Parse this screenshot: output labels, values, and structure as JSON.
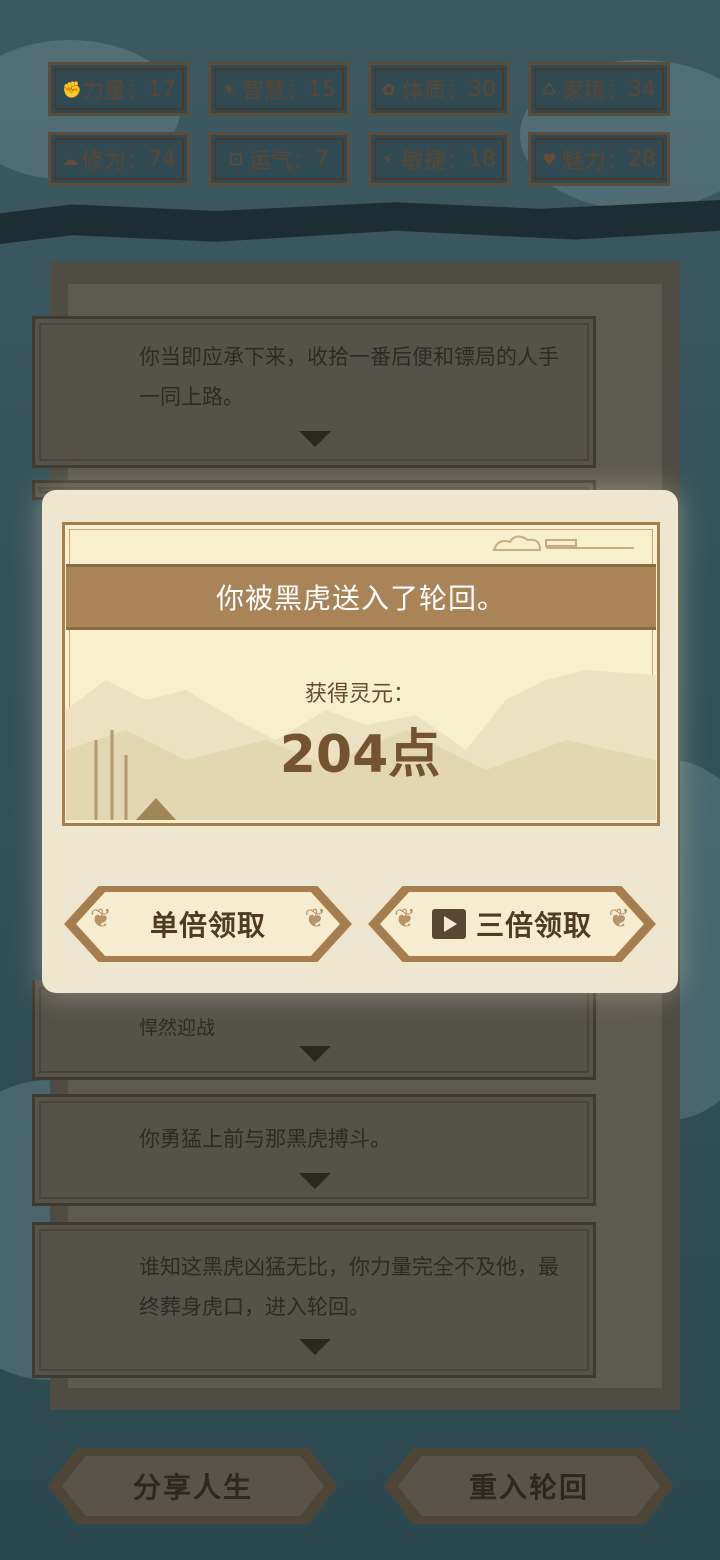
{
  "stats": [
    {
      "icon": "fist-icon",
      "glyph": "✊",
      "label": "力量",
      "value": "17"
    },
    {
      "icon": "bulb-icon",
      "glyph": "☀",
      "label": "智慧",
      "value": "15"
    },
    {
      "icon": "flower-icon",
      "glyph": "✿",
      "label": "体质",
      "value": "30"
    },
    {
      "icon": "hands-icon",
      "glyph": "♺",
      "label": "家境",
      "value": "34"
    },
    {
      "icon": "cloud-icon",
      "glyph": "☁",
      "label": "修为",
      "value": "74"
    },
    {
      "icon": "dice-icon",
      "glyph": "⚀",
      "label": "运气",
      "value": " 7"
    },
    {
      "icon": "lightning-icon",
      "glyph": "⚡",
      "label": "敏捷",
      "value": "18"
    },
    {
      "icon": "heart-icon",
      "glyph": "♥",
      "label": "魅力",
      "value": "28"
    }
  ],
  "story": {
    "entries": [
      {
        "text": "你当即应承下来，收拾一番后便和镖局的人手一同上路。"
      },
      {
        "text": "悍然迎战"
      },
      {
        "text": "你勇猛上前与那黑虎搏斗。"
      },
      {
        "text": "谁知这黑虎凶猛无比，你力量完全不及他，最终葬身虎口，进入轮回。"
      }
    ]
  },
  "modal": {
    "title": "你被黑虎送入了轮回。",
    "reward_label": "获得灵元：",
    "reward_value": "204点",
    "single_button": "单倍领取",
    "triple_button": "三倍领取"
  },
  "bottom": {
    "share_button": "分享人生",
    "restart_button": "重入轮回"
  },
  "colors": {
    "accent": "#a98458",
    "text_brown": "#735331"
  }
}
